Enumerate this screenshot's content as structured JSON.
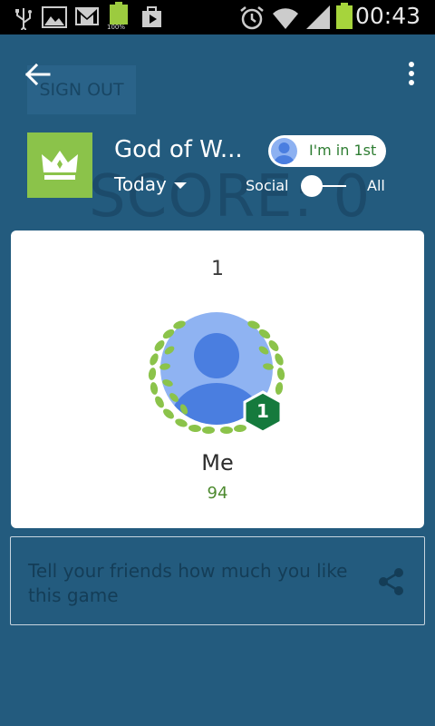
{
  "status_bar": {
    "time": "00:43",
    "battery_label": "100%",
    "icons": [
      "usb-icon",
      "image-icon",
      "gmail-icon",
      "battery-icon",
      "play-store-icon",
      "alarm-icon",
      "wifi-icon",
      "signal-icon",
      "battery-full-icon"
    ]
  },
  "background": {
    "signout_label": "SIGN OUT",
    "score_label": "SCORE: 0"
  },
  "toolbar": {
    "back_icon": "arrow-back-icon",
    "overflow_icon": "more-vert-icon"
  },
  "game": {
    "title": "God of W...",
    "icon": "crown-icon",
    "rank_badge_label": "I'm in 1st",
    "time_filter": "Today",
    "toggle_left_label": "Social",
    "toggle_right_label": "All"
  },
  "leaderboard": {
    "rank": "1",
    "player_name": "Me",
    "score": "94",
    "rank_badge_number": "1"
  },
  "share": {
    "text": "Tell your friends how much you like this game",
    "icon": "share-icon"
  },
  "colors": {
    "background": "#235b7e",
    "accent_green": "#8bc34a",
    "rank_green": "#2e7d32",
    "badge_green": "#157a3d",
    "avatar_blue": "#4a7ee0"
  }
}
